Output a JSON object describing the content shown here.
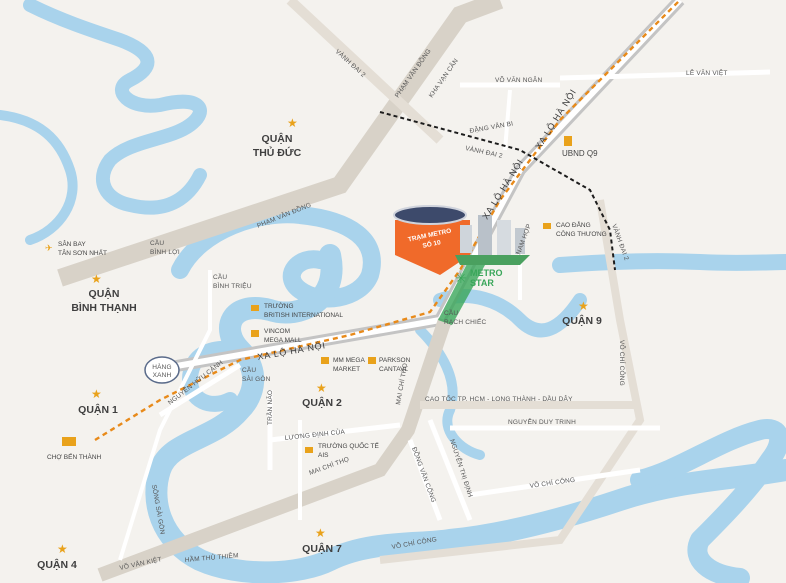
{
  "colors": {
    "water": "#a9d3ec",
    "land": "#f4f2ee",
    "road_major": "#d8d2c8",
    "road_minor": "#ffffff",
    "metro_line": "#e88a1a",
    "ring_road": "#1c1c1c",
    "project": "#f06a2a",
    "star": "#e9a21b",
    "green_park": "#3aa65a"
  },
  "districts": {
    "thu_duc": [
      "QUẬN",
      "THỦ ĐỨC"
    ],
    "binh_thanh": [
      "QUẬN",
      "BÌNH THẠNH"
    ],
    "quan_1": "QUẬN 1",
    "quan_2": "QUẬN 2",
    "quan_4": "QUẬN 4",
    "quan_7": "QUẬN 7",
    "quan_9": "QUẬN 9"
  },
  "roads": {
    "vanh_dai_2_top": "VÀNH ĐAI 2",
    "pham_van_dong_top": "PHẠM VĂN ĐỒNG",
    "kha_van_can": "KHA VẠN CÂN",
    "vo_van_ngan": "VÕ VĂN NGÂN",
    "le_van_viet": "LÊ VĂN VIỆT",
    "dang_van_bi": "ĐẶNG VĂN BI",
    "vanh_dai_2_mid": "VÀNH ĐAI 2",
    "xa_lo_ha_noi_ne": "XA LỘ HÀ NỘI",
    "xa_lo_ha_noi_nw": "XA LỘ HÀ NỘI",
    "xa_lo_ha_noi_sw": "XA LỘ HÀ NỘI",
    "pham_van_dong_mid": "PHẠM VĂN ĐỒNG",
    "vanh_dai_2_right": "VÀNH ĐAI 2",
    "nam_hop": "NAM HỢP",
    "vo_chi_cong_right": "VÕ CHÍ CÔNG",
    "cao_toc": "CAO TỐC TP. HCM - LONG THÀNH - DẦU DÂY",
    "nguyen_duy_trinh": "NGUYỄN DUY TRINH",
    "vo_chi_cong_mid": "VÕ CHÍ CÔNG",
    "vo_chi_cong_bottom": "VÕ CHÍ CÔNG",
    "mai_chi_tho_v": "MAI CHÍ THỌ",
    "mai_chi_tho_h": "MAI CHÍ THỌ",
    "luong_dinh_cua": "LƯƠNG ĐỊNH CỦA",
    "tran_nao": "TRẦN NÃO",
    "nguyen_huu_canh": "NGUYỄN HỮU CẢNH",
    "dong_van_cong": "ĐỒNG VĂN CỐNG",
    "nguyen_thi_dinh": "NGUYỄN THỊ ĐỊNH",
    "vo_van_kiet": "VÕ VĂN KIỆT",
    "ham_thu_thiem": "HẦM THỦ THIÊM",
    "song_sai_gon": "SÔNG SÀI GÒN",
    "hang_xanh": [
      "HÀNG",
      "XANH"
    ]
  },
  "bridges": {
    "binh_loi": [
      "CẦU",
      "BÌNH LỢI"
    ],
    "binh_trieu": [
      "CẦU",
      "BÌNH TRIỆU"
    ],
    "sai_gon": [
      "CẦU",
      "SÀI GÒN"
    ],
    "rach_chiec": [
      "CẦU",
      "RẠCH CHIẾC"
    ]
  },
  "pois": {
    "airport": [
      "SÂN BAY",
      "TÂN SƠN NHẤT"
    ],
    "british": [
      "TRƯỜNG",
      "BRITISH INTERNATIONAL"
    ],
    "vincom": [
      "VINCOM",
      "MEGA MALL"
    ],
    "mm_mega": [
      "MM MEGA",
      "MARKET"
    ],
    "parkson": [
      "PARKSON",
      "CANTAVL"
    ],
    "quoc_te": [
      "TRƯỜNG QUỐC TẾ",
      "AIS"
    ],
    "ben_thanh": "CHỢ BẾN THÀNH",
    "cao_dang": [
      "CAO ĐẲNG",
      "CÔNG THƯƠNG"
    ],
    "ubnd": "UBND Q9"
  },
  "project": {
    "station": [
      "TRẠM METRO",
      "SỐ 10"
    ],
    "brand_line1": "METRO",
    "brand_line2": "STAR"
  }
}
